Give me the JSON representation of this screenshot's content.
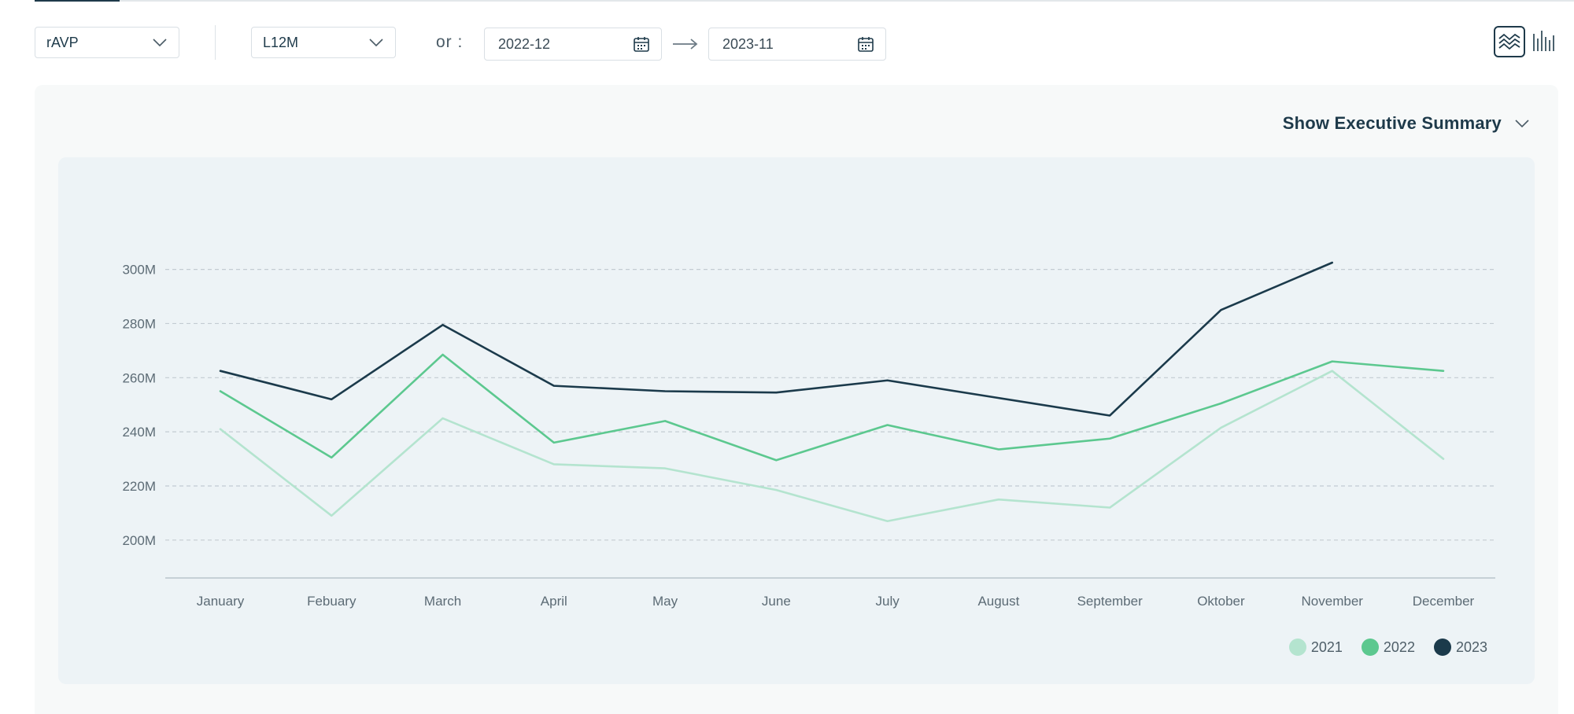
{
  "toolbar": {
    "metric_select": {
      "value": "rAVP"
    },
    "period_select": {
      "value": "L12M"
    },
    "or_label": "or :",
    "date_start": "2022-12",
    "date_end": "2023-11",
    "view_toggle": {
      "active": "line-view-icon",
      "inactive": "bar-view-icon"
    }
  },
  "panel": {
    "summary_toggle_label": "Show Executive Summary"
  },
  "colors": {
    "2021": "#b4e4cf",
    "2022": "#5cc88f",
    "2023": "#1b3a4b",
    "grid": "#c3ccd2",
    "axis": "#b9c4cb"
  },
  "chart_data": {
    "type": "line",
    "categories": [
      "January",
      "Febuary",
      "March",
      "April",
      "May",
      "June",
      "July",
      "August",
      "September",
      "Oktober",
      "November",
      "December"
    ],
    "y_ticks": [
      "200M",
      "220M",
      "240M",
      "260M",
      "280M",
      "300M"
    ],
    "y_tick_values": [
      200,
      220,
      240,
      260,
      280,
      300
    ],
    "ylim": [
      186,
      324
    ],
    "grid": true,
    "legend_position": "bottom-right",
    "series": [
      {
        "name": "2021",
        "values": [
          241,
          209,
          245,
          228,
          226.5,
          218.5,
          207,
          215,
          212,
          241.5,
          262.5,
          230
        ]
      },
      {
        "name": "2022",
        "values": [
          255,
          230.5,
          268.5,
          236,
          244,
          229.5,
          242.5,
          233.5,
          237.5,
          250.5,
          266,
          262.5
        ]
      },
      {
        "name": "2023",
        "values": [
          262.5,
          252,
          279.5,
          257,
          255,
          254.5,
          259,
          252.5,
          246,
          285,
          302.5
        ]
      }
    ]
  }
}
